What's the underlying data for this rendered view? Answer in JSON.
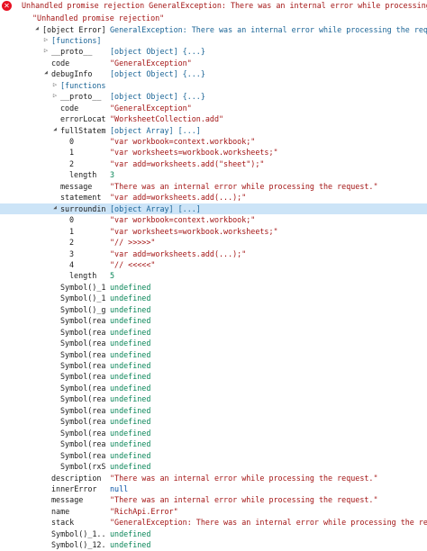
{
  "header": {
    "message": "Unhandled promise rejection GeneralException: There was an internal error while processing the request.",
    "subtitle": "\"Unhandled promise rejection\""
  },
  "rows": [
    {
      "key": "[object Error]",
      "value": "GeneralException: There was an internal error while processing the request.",
      "arrow": "down",
      "level": 0,
      "vtype": "obj"
    },
    {
      "key": "[functions]",
      "value": "",
      "arrow": "right",
      "level": 1,
      "vtype": "obj",
      "keytype": "obj"
    },
    {
      "key": "__proto__",
      "value": "[object Object] {...}",
      "arrow": "right",
      "level": 1,
      "vtype": "obj"
    },
    {
      "key": "code",
      "value": "\"GeneralException\"",
      "arrow": "",
      "level": 1,
      "vtype": "str"
    },
    {
      "key": "debugInfo",
      "value": "[object Object] {...}",
      "arrow": "down",
      "level": 1,
      "vtype": "obj"
    },
    {
      "key": "[functions]",
      "value": "",
      "arrow": "right",
      "level": 2,
      "vtype": "obj",
      "keytype": "obj"
    },
    {
      "key": "__proto__",
      "value": "[object Object] {...}",
      "arrow": "right",
      "level": 2,
      "vtype": "obj"
    },
    {
      "key": "code",
      "value": "\"GeneralException\"",
      "arrow": "",
      "level": 2,
      "vtype": "str"
    },
    {
      "key": "errorLocat...",
      "value": "\"WorksheetCollection.add\"",
      "arrow": "",
      "level": 2,
      "vtype": "str"
    },
    {
      "key": "fullStatem...",
      "value": "[object Array] [...]",
      "arrow": "down",
      "level": 2,
      "vtype": "obj"
    },
    {
      "key": "0",
      "value": "\"var workbook=context.workbook;\"",
      "arrow": "",
      "level": 3,
      "vtype": "str"
    },
    {
      "key": "1",
      "value": "\"var worksheets=workbook.worksheets;\"",
      "arrow": "",
      "level": 3,
      "vtype": "str"
    },
    {
      "key": "2",
      "value": "\"var add=worksheets.add(\"sheet\");\"",
      "arrow": "",
      "level": 3,
      "vtype": "str"
    },
    {
      "key": "length",
      "value": "3",
      "arrow": "",
      "level": 3,
      "vtype": "grn"
    },
    {
      "key": "message",
      "value": "\"There was an internal error while processing the request.\"",
      "arrow": "",
      "level": 2,
      "vtype": "str"
    },
    {
      "key": "statement",
      "value": "\"var add=worksheets.add(...);\"",
      "arrow": "",
      "level": 2,
      "vtype": "str"
    },
    {
      "key": "surroundin...",
      "value": "[object Array] [...]",
      "arrow": "down",
      "level": 2,
      "vtype": "obj",
      "selected": true
    },
    {
      "key": "0",
      "value": "\"var workbook=context.workbook;\"",
      "arrow": "",
      "level": 3,
      "vtype": "str"
    },
    {
      "key": "1",
      "value": "\"var worksheets=workbook.worksheets;\"",
      "arrow": "",
      "level": 3,
      "vtype": "str"
    },
    {
      "key": "2",
      "value": "\"// >>>>>\"",
      "arrow": "",
      "level": 3,
      "vtype": "str"
    },
    {
      "key": "3",
      "value": "\"var add=worksheets.add(...);\"",
      "arrow": "",
      "level": 3,
      "vtype": "str"
    },
    {
      "key": "4",
      "value": "\"// <<<<<\"",
      "arrow": "",
      "level": 3,
      "vtype": "str"
    },
    {
      "key": "length",
      "value": "5",
      "arrow": "",
      "level": 3,
      "vtype": "grn"
    },
    {
      "key": "Symbol()_1...",
      "value": "undefined",
      "arrow": "",
      "level": 2,
      "vtype": "grn"
    },
    {
      "key": "Symbol()_1...",
      "value": "undefined",
      "arrow": "",
      "level": 2,
      "vtype": "grn"
    },
    {
      "key": "Symbol()_g...",
      "value": "undefined",
      "arrow": "",
      "level": 2,
      "vtype": "grn"
    },
    {
      "key": "Symbol(rea...",
      "value": "undefined",
      "arrow": "",
      "level": 2,
      "vtype": "grn"
    },
    {
      "key": "Symbol(rea...",
      "value": "undefined",
      "arrow": "",
      "level": 2,
      "vtype": "grn"
    },
    {
      "key": "Symbol(rea...",
      "value": "undefined",
      "arrow": "",
      "level": 2,
      "vtype": "grn"
    },
    {
      "key": "Symbol(rea...",
      "value": "undefined",
      "arrow": "",
      "level": 2,
      "vtype": "grn"
    },
    {
      "key": "Symbol(rea...",
      "value": "undefined",
      "arrow": "",
      "level": 2,
      "vtype": "grn"
    },
    {
      "key": "Symbol(rea...",
      "value": "undefined",
      "arrow": "",
      "level": 2,
      "vtype": "grn"
    },
    {
      "key": "Symbol(rea...",
      "value": "undefined",
      "arrow": "",
      "level": 2,
      "vtype": "grn"
    },
    {
      "key": "Symbol(rea...",
      "value": "undefined",
      "arrow": "",
      "level": 2,
      "vtype": "grn"
    },
    {
      "key": "Symbol(rea...",
      "value": "undefined",
      "arrow": "",
      "level": 2,
      "vtype": "grn"
    },
    {
      "key": "Symbol(rea...",
      "value": "undefined",
      "arrow": "",
      "level": 2,
      "vtype": "grn"
    },
    {
      "key": "Symbol(rea...",
      "value": "undefined",
      "arrow": "",
      "level": 2,
      "vtype": "grn"
    },
    {
      "key": "Symbol(rea...",
      "value": "undefined",
      "arrow": "",
      "level": 2,
      "vtype": "grn"
    },
    {
      "key": "Symbol(rea...",
      "value": "undefined",
      "arrow": "",
      "level": 2,
      "vtype": "grn"
    },
    {
      "key": "Symbol(rxS...",
      "value": "undefined",
      "arrow": "",
      "level": 2,
      "vtype": "grn"
    },
    {
      "key": "description",
      "value": "\"There was an internal error while processing the request.\"",
      "arrow": "",
      "level": 1,
      "vtype": "str"
    },
    {
      "key": "innerError",
      "value": "null",
      "arrow": "",
      "level": 1,
      "vtype": "blu"
    },
    {
      "key": "message",
      "value": "\"There was an internal error while processing the request.\"",
      "arrow": "",
      "level": 1,
      "vtype": "str"
    },
    {
      "key": "name",
      "value": "\"RichApi.Error\"",
      "arrow": "",
      "level": 1,
      "vtype": "str"
    },
    {
      "key": "stack",
      "value": "\"GeneralException: There was an internal error while processing the request. ...",
      "arrow": "",
      "level": 1,
      "vtype": "str"
    },
    {
      "key": "Symbol()_1...",
      "value": "undefined",
      "arrow": "",
      "level": 1,
      "vtype": "grn"
    },
    {
      "key": "Symbol()_12...",
      "value": "undefined",
      "arrow": "",
      "level": 1,
      "vtype": "grn"
    }
  ]
}
